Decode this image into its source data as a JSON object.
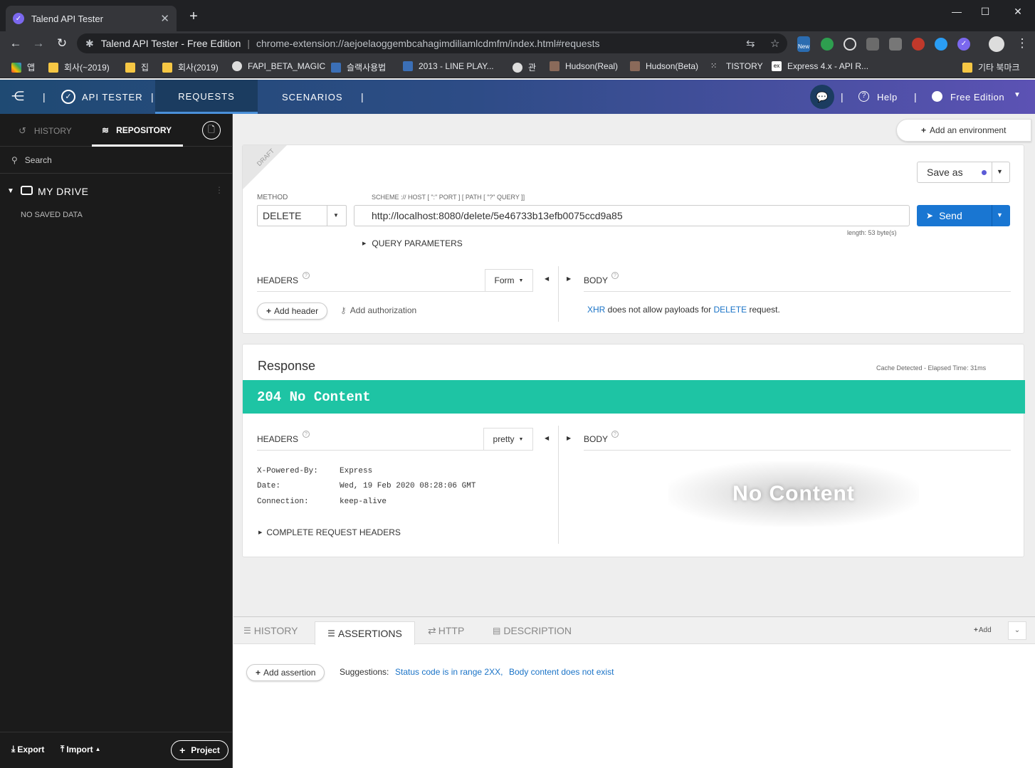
{
  "browser": {
    "tab_title": "Talend API Tester",
    "new_tab": "+",
    "site_name": "Talend API Tester - Free Edition",
    "url": "chrome-extension://aejoelaoggembcahagimdiliamlcdmfm/index.html#requests",
    "ext_new_badge": "New",
    "bookmarks": [
      {
        "label": "앱"
      },
      {
        "label": "회사(~2019)"
      },
      {
        "label": "집"
      },
      {
        "label": "회사(2019)"
      },
      {
        "label": "FAPI_BETA_MAGIC"
      },
      {
        "label": "슬랙사용법"
      },
      {
        "label": "2013 - LINE PLAY..."
      },
      {
        "label": "관"
      },
      {
        "label": "Hudson(Real)"
      },
      {
        "label": "Hudson(Beta)"
      },
      {
        "label": "TISTORY"
      },
      {
        "label": "Express 4.x - API R..."
      }
    ],
    "other_bookmarks": "기타 북마크"
  },
  "header": {
    "app_name": "API TESTER",
    "tabs": [
      "REQUESTS",
      "SCENARIOS"
    ],
    "help": "Help",
    "edition": "Free Edition"
  },
  "sidebar": {
    "tab_history": "HISTORY",
    "tab_repository": "REPOSITORY",
    "search_placeholder": "Search",
    "drive_label": "MY DRIVE",
    "empty_text": "NO SAVED DATA",
    "export": "Export",
    "import": "Import",
    "project": "Project"
  },
  "request": {
    "add_environment": "Add an environment",
    "draft_ribbon": "DRAFT",
    "save_as": "Save as",
    "method_label": "METHOD",
    "method_value": "DELETE",
    "url_label": "SCHEME :// HOST [ \":\" PORT ] [ PATH [ \"?\" QUERY ]]",
    "url_value": "http://localhost:8080/delete/5e46733b13efb0075ccd9a85",
    "length_text": "length: 53 byte(s)",
    "send": "Send",
    "query_params": "QUERY PARAMETERS",
    "headers_label": "HEADERS",
    "headers_mode": "Form",
    "body_label": "BODY",
    "add_header": "Add header",
    "add_authorization": "Add authorization",
    "body_note_xhr": "XHR",
    "body_note_mid": " does not allow payloads for ",
    "body_note_method": "DELETE",
    "body_note_end": " request."
  },
  "response": {
    "title": "Response",
    "meta": "Cache Detected - Elapsed Time: 31ms",
    "status": "204 No Content",
    "status_color": "#1ec4a4",
    "headers_label": "HEADERS",
    "format": "pretty",
    "body_label": "BODY",
    "headers": [
      {
        "name": "X-Powered-By:",
        "value": "Express"
      },
      {
        "name": "Date:",
        "value": "Wed, 19 Feb 2020 08:28:06 GMT"
      },
      {
        "name": "Connection:",
        "value": "keep-alive"
      }
    ],
    "complete_headers": "COMPLETE REQUEST HEADERS",
    "body_watermark": "No Content"
  },
  "bottom": {
    "tabs": [
      "HISTORY",
      "ASSERTIONS",
      "HTTP",
      "DESCRIPTION"
    ],
    "add": "Add",
    "add_assertion": "Add assertion",
    "suggestions_label": "Suggestions:",
    "suggestion_1": "Status code is in range 2XX,",
    "suggestion_2": "Body content does not exist"
  }
}
